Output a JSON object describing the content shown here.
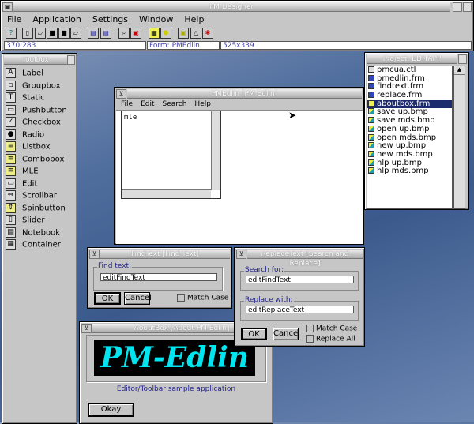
{
  "app": {
    "title": "PM Designer",
    "menu": [
      "File",
      "Application",
      "Settings",
      "Window",
      "Help"
    ],
    "status": {
      "coords": "370:283",
      "form": "Form: PMEdlin",
      "size": "525x339"
    },
    "toolbar_icons": [
      "help-icon",
      "new-icon",
      "open-icon",
      "save-icon",
      "save-all-icon",
      "save-as-icon",
      "window-icon",
      "dialog-icon",
      "find-icon",
      "replace-icon",
      "cube-icon",
      "shape-icon",
      "frame-icon",
      "warning-icon",
      "bug-icon"
    ]
  },
  "toolbox": {
    "title": "Toolbox",
    "items": [
      "Label",
      "Groupbox",
      "Static",
      "Pushbutton",
      "Checkbox",
      "Radio",
      "Listbox",
      "Combobox",
      "MLE",
      "Edit",
      "Scrollbar",
      "Spinbutton",
      "Slider",
      "Notebook",
      "Container"
    ]
  },
  "project": {
    "title": "Project: EDITAPP",
    "selected": "aboutbox.frm",
    "files": [
      "pmcua.ctl",
      "pmedlin.frm",
      "findtext.frm",
      "replace.frm",
      "aboutbox.frm",
      "save  up.bmp",
      "save  mds.bmp",
      "open  up.bmp",
      "open  mds.bmp",
      "new  up.bmp",
      "new  mds.bmp",
      "hlp  up.bmp",
      "hlp  mds.bmp"
    ]
  },
  "edlin": {
    "title": "PMEdlin [PM Edlin]",
    "menu": [
      "File",
      "Edit",
      "Search",
      "Help"
    ],
    "mle_text": "mle"
  },
  "findtext": {
    "title": "FindText [Find Text]",
    "group": "Find text:",
    "field": "editFindText",
    "ok": "OK",
    "cancel": "Cancel",
    "match_case": "Match Case"
  },
  "replace": {
    "title": "ReplaceText [Search and Replace]",
    "search_label": "Search for:",
    "search_field": "editFindText",
    "replace_label": "Replace with:",
    "replace_field": "editReplaceText",
    "ok": "OK",
    "cancel": "Cancel",
    "match_case": "Match Case",
    "replace_all": "Replace All"
  },
  "about": {
    "title": "AboutBox [About PM Edlin]",
    "logo": "PM-Edlin",
    "subtitle": "Editor/Toolbar sample application",
    "okay": "Okay"
  },
  "colors": {
    "selection": "#1c2a6e",
    "logo_text": "#00e5f0",
    "label_blue": "#22228a"
  }
}
